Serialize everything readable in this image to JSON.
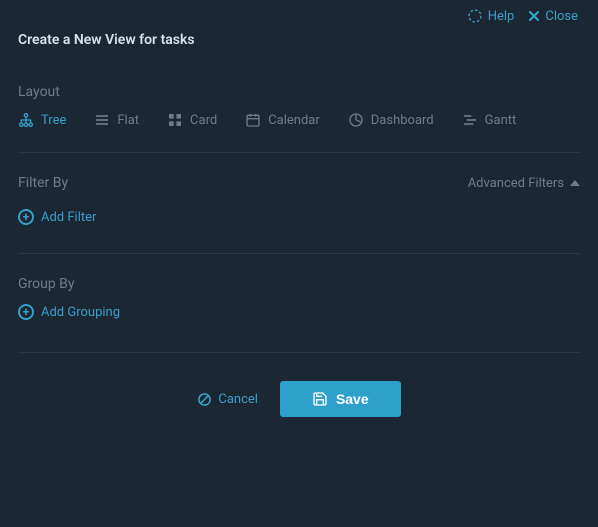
{
  "header": {
    "help_label": "Help",
    "close_label": "Close",
    "title": "Create a New View for tasks"
  },
  "layout": {
    "section_label": "Layout",
    "options": [
      {
        "id": "tree",
        "label": "Tree",
        "active": true
      },
      {
        "id": "flat",
        "label": "Flat",
        "active": false
      },
      {
        "id": "card",
        "label": "Card",
        "active": false
      },
      {
        "id": "calendar",
        "label": "Calendar",
        "active": false
      },
      {
        "id": "dashboard",
        "label": "Dashboard",
        "active": false
      },
      {
        "id": "gantt",
        "label": "Gantt",
        "active": false
      }
    ]
  },
  "filter": {
    "section_label": "Filter By",
    "advanced_label": "Advanced Filters",
    "add_label": "Add Filter"
  },
  "group": {
    "section_label": "Group By",
    "add_label": "Add Grouping"
  },
  "footer": {
    "cancel_label": "Cancel",
    "save_label": "Save"
  },
  "colors": {
    "accent": "#37a0c9",
    "bg": "#1b2733",
    "muted": "#6d7d8c"
  }
}
